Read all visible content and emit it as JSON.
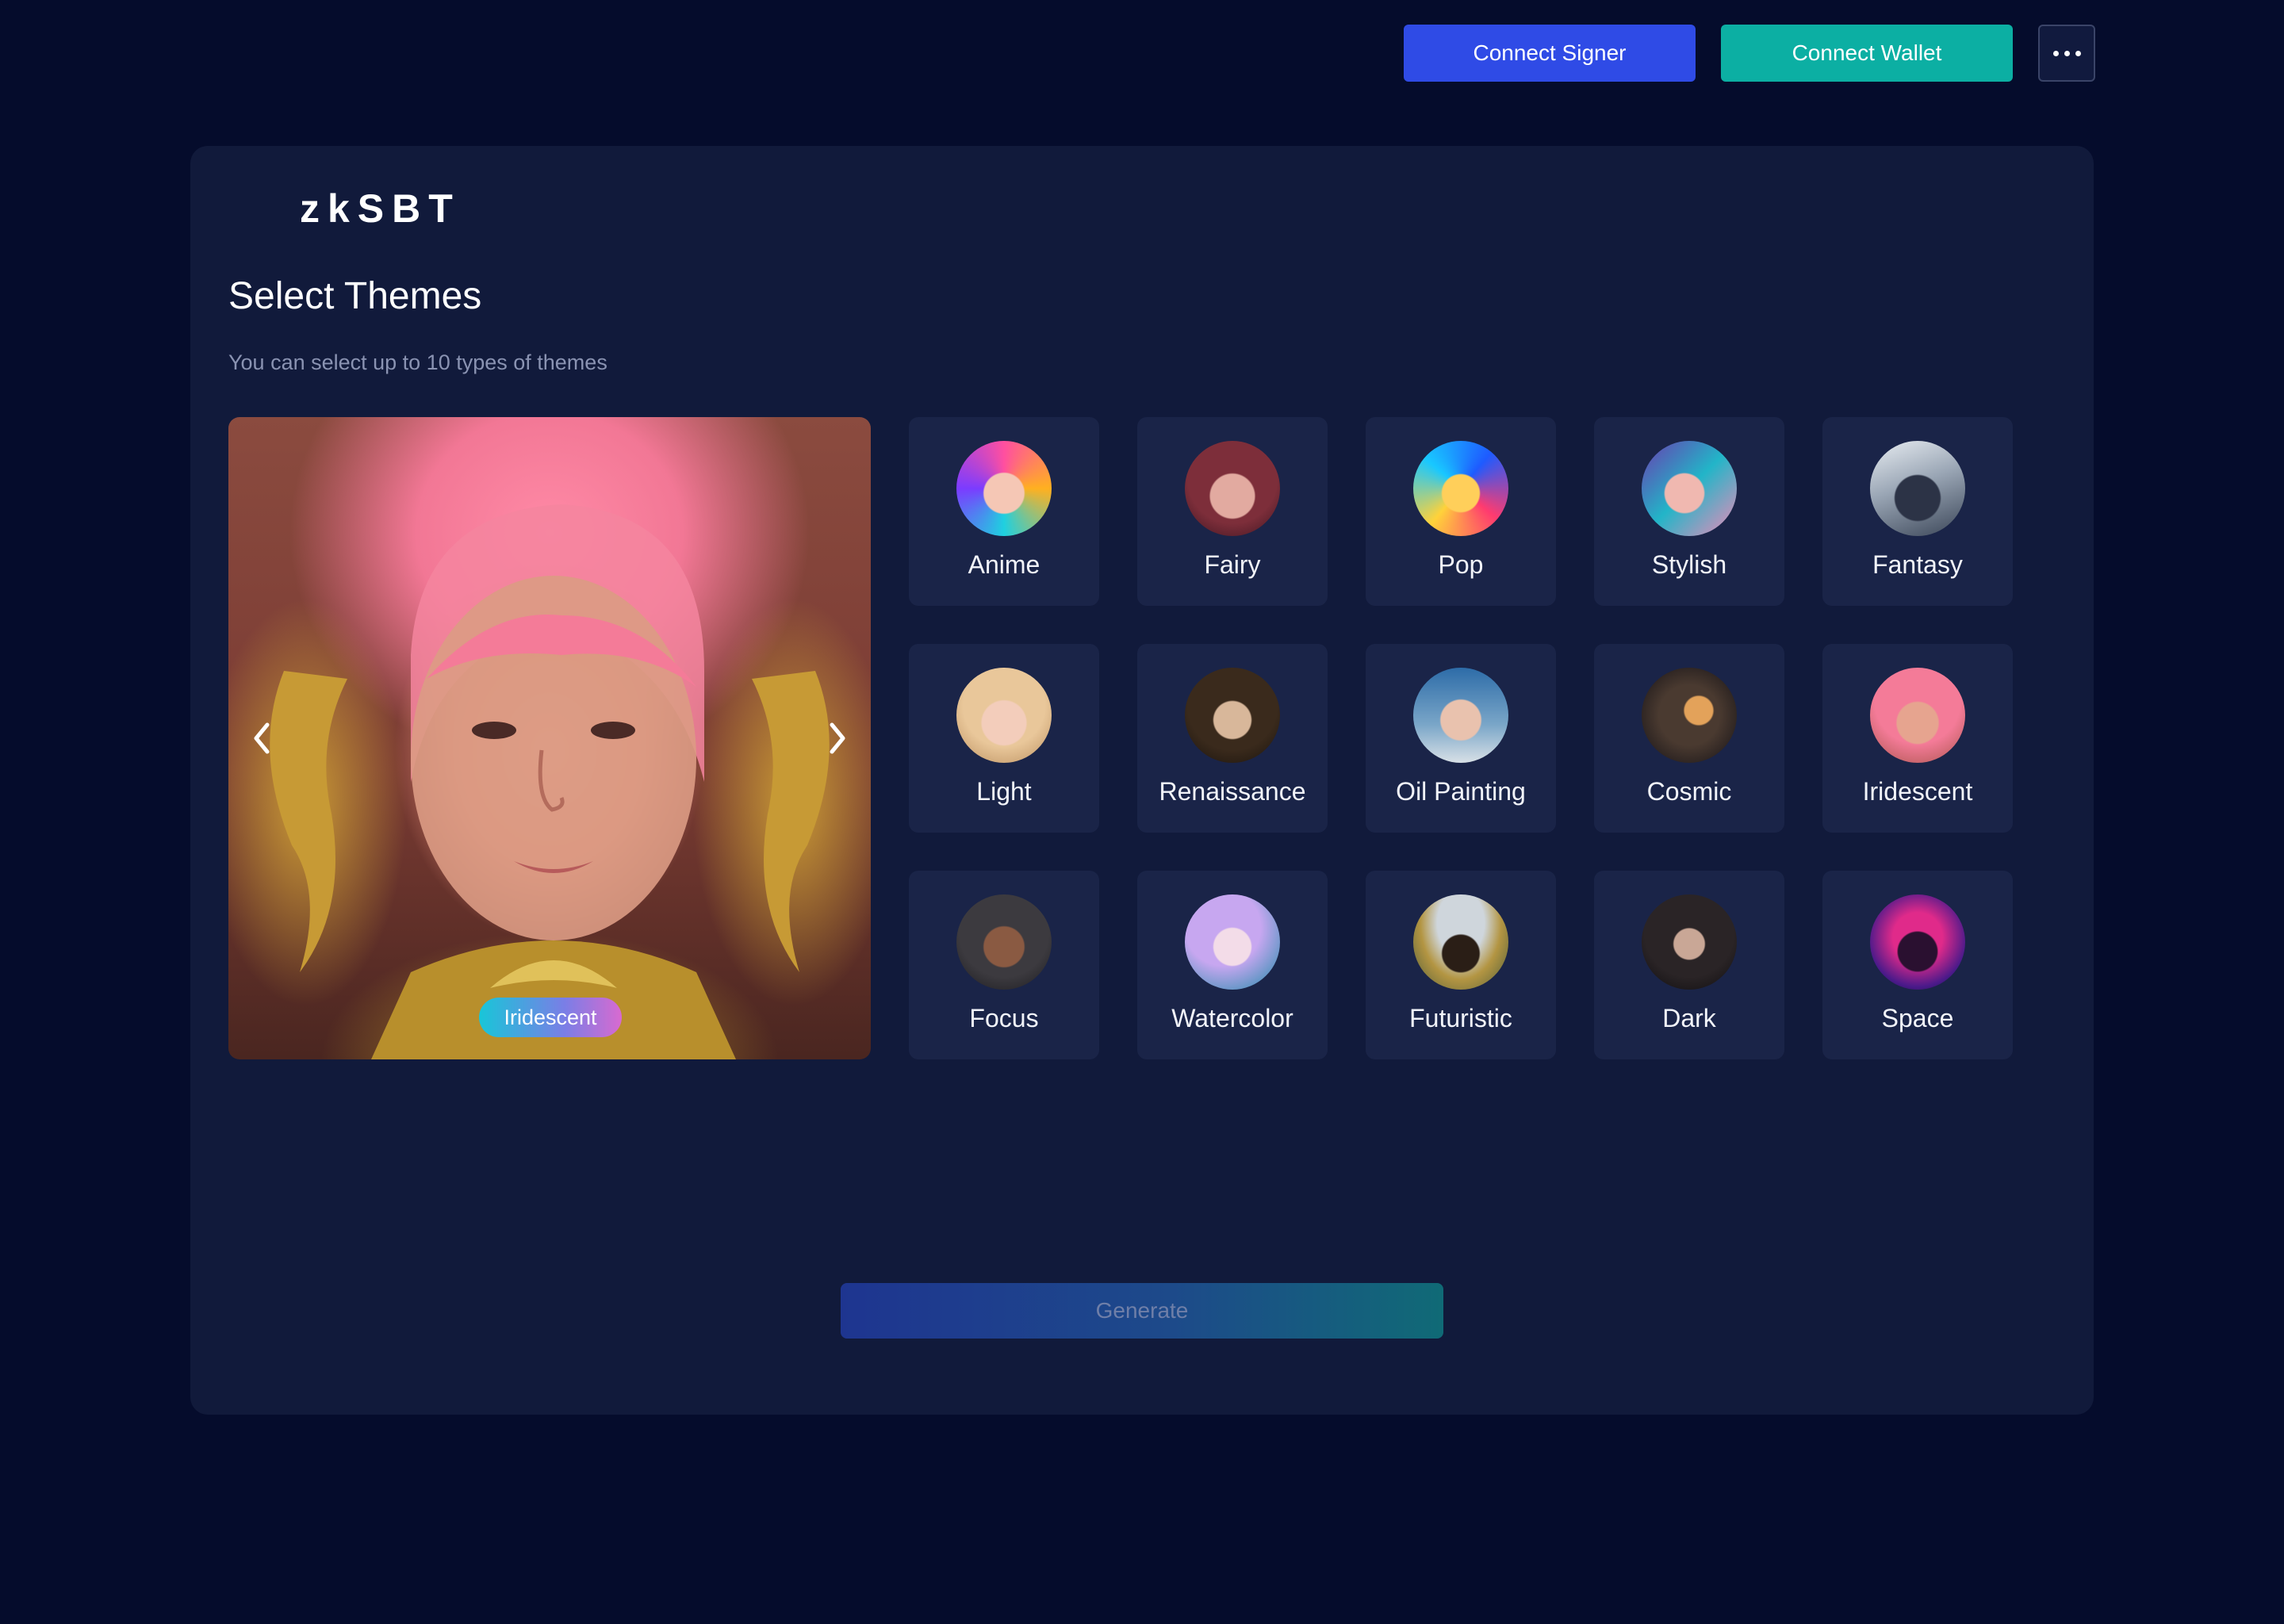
{
  "header": {
    "connect_signer_label": "Connect Signer",
    "connect_wallet_label": "Connect Wallet",
    "more_icon": "more-dots-icon"
  },
  "app": {
    "logo": "zkSBT",
    "title": "Select Themes",
    "subtitle": "You can select up to 10 types of themes"
  },
  "preview": {
    "current_theme": "Iridescent",
    "prev_icon": "chevron-left-icon",
    "next_icon": "chevron-right-icon"
  },
  "themes": [
    {
      "label": "Anime"
    },
    {
      "label": "Fairy"
    },
    {
      "label": "Pop"
    },
    {
      "label": "Stylish"
    },
    {
      "label": "Fantasy"
    },
    {
      "label": "Light"
    },
    {
      "label": "Renaissance"
    },
    {
      "label": "Oil Painting"
    },
    {
      "label": "Cosmic"
    },
    {
      "label": "Iridescent"
    },
    {
      "label": "Focus"
    },
    {
      "label": "Watercolor"
    },
    {
      "label": "Futuristic"
    },
    {
      "label": "Dark"
    },
    {
      "label": "Space"
    }
  ],
  "actions": {
    "generate_label": "Generate"
  },
  "colors": {
    "background": "#050c2c",
    "card": "#111a3b",
    "tile": "#1a2448",
    "signer_button": "#2f4be6",
    "wallet_button": "#0cafa3"
  }
}
